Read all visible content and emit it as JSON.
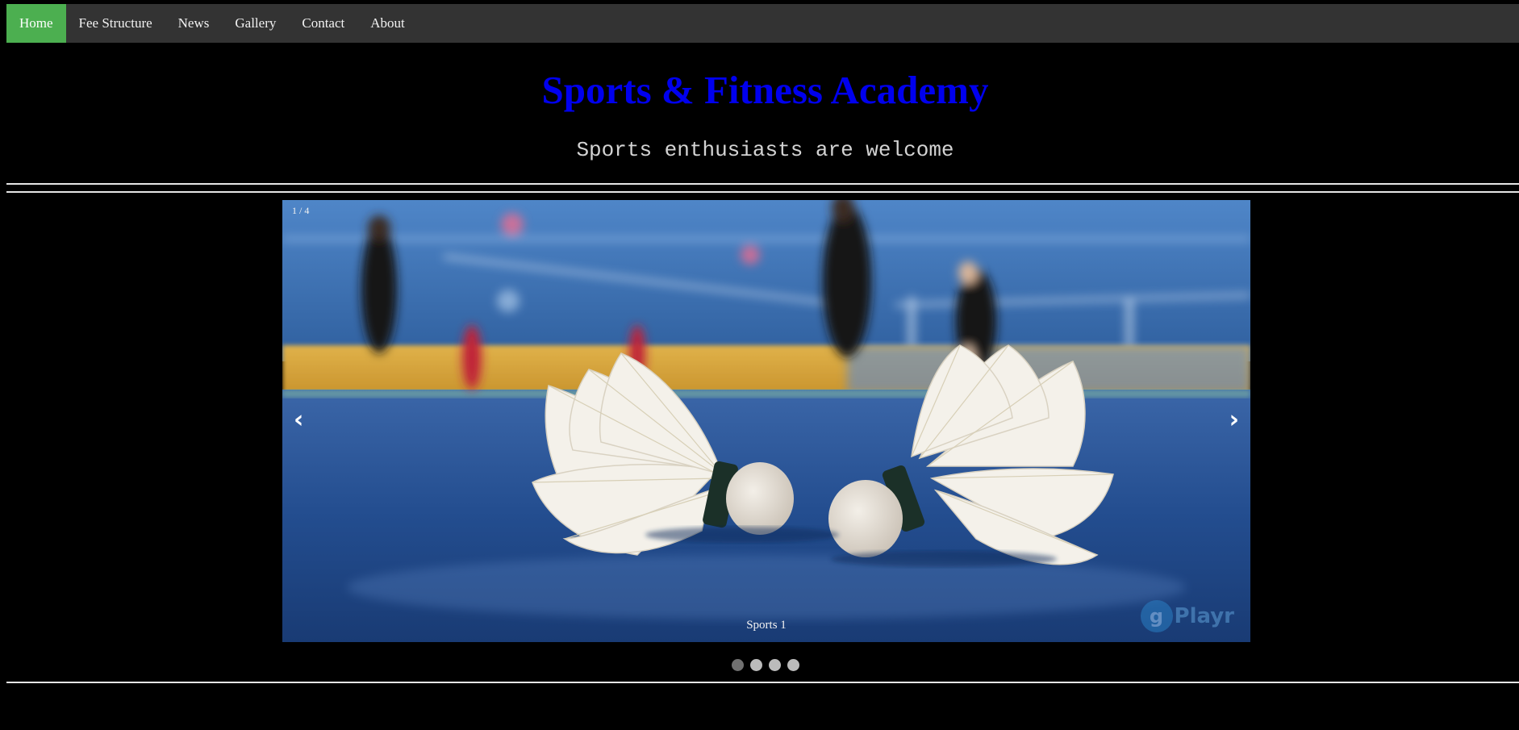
{
  "nav": {
    "items": [
      {
        "label": "Home",
        "active": true
      },
      {
        "label": "Fee Structure",
        "active": false
      },
      {
        "label": "News",
        "active": false
      },
      {
        "label": "Gallery",
        "active": false
      },
      {
        "label": "Contact",
        "active": false
      },
      {
        "label": "About",
        "active": false
      }
    ]
  },
  "header": {
    "title": "Sports & Fitness Academy",
    "tagline": "Sports enthusiasts are welcome"
  },
  "slideshow": {
    "counter": "1 / 4",
    "caption": "Sports 1",
    "prev": "‹",
    "next": "›",
    "watermark_text": "Playr",
    "watermark_glyph": "g",
    "dots_total": 4,
    "active_index": 0
  },
  "colors": {
    "nav_bg": "#333333",
    "nav_active": "#4CAF50",
    "title": "#0000EE",
    "tagline": "#D3D3D3",
    "background": "#000000"
  }
}
